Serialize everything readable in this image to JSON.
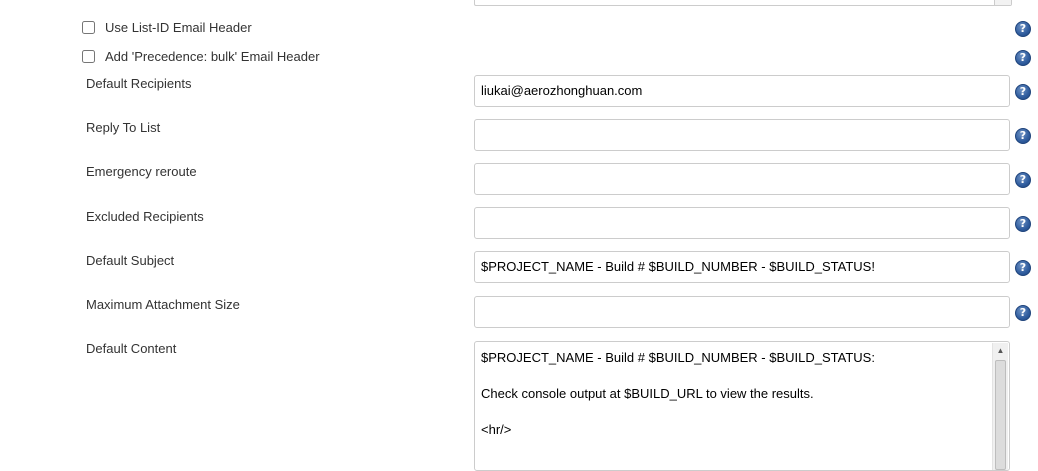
{
  "checkboxes": [
    {
      "label": "Use List-ID Email Header",
      "checked": false
    },
    {
      "label": "Add 'Precedence: bulk' Email Header",
      "checked": false
    }
  ],
  "fields": {
    "default_recipients": {
      "label": "Default Recipients",
      "value": "liukai@aerozhonghuan.com"
    },
    "reply_to_list": {
      "label": "Reply To List",
      "value": ""
    },
    "emergency_reroute": {
      "label": "Emergency reroute",
      "value": ""
    },
    "excluded_recipients": {
      "label": "Excluded Recipients",
      "value": ""
    },
    "default_subject": {
      "label": "Default Subject",
      "value": "$PROJECT_NAME - Build # $BUILD_NUMBER - $BUILD_STATUS!"
    },
    "max_attachment_size": {
      "label": "Maximum Attachment Size",
      "value": ""
    },
    "default_content": {
      "label": "Default Content",
      "lines": [
        "$PROJECT_NAME - Build # $BUILD_NUMBER - $BUILD_STATUS:",
        "",
        "Check console output at $BUILD_URL to view the results.",
        "",
        "<hr/>"
      ]
    }
  },
  "help_icon_glyph": "?",
  "colors": {
    "help_icon": "#2f5c9e",
    "border": "#cccccc"
  }
}
